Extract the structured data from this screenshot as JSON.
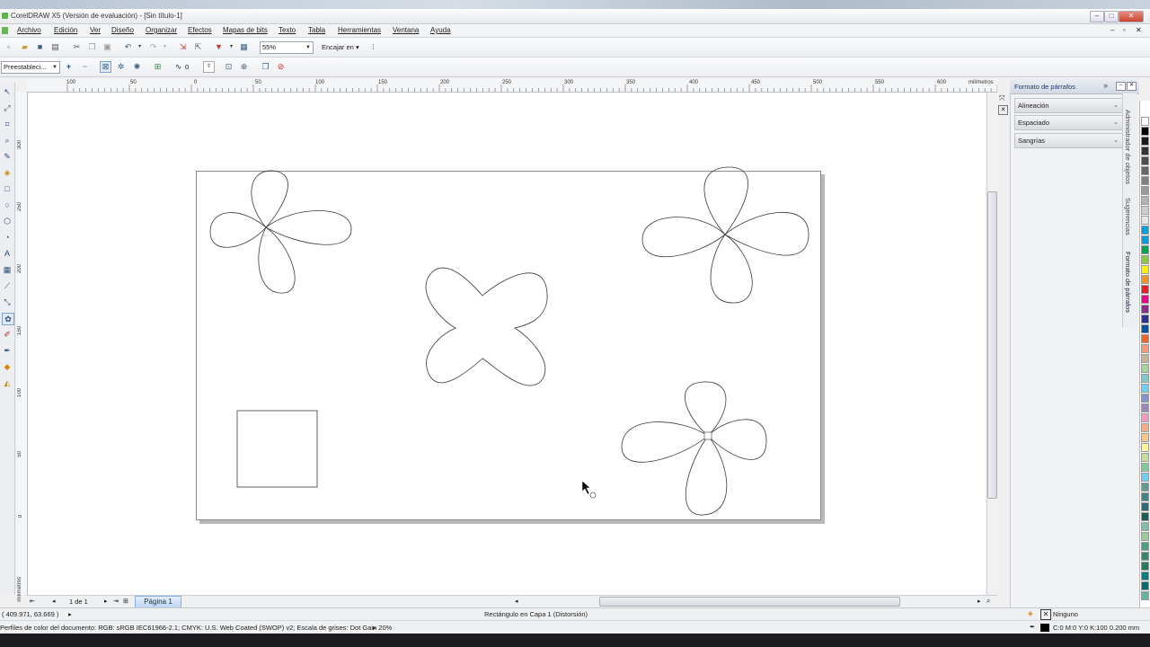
{
  "window": {
    "title": "CorelDRAW X5 (Versión de evaluación) - [Sin título-1]"
  },
  "menu": [
    "Archivo",
    "Edición",
    "Ver",
    "Diseño",
    "Organizar",
    "Efectos",
    "Mapas de bits",
    "Texto",
    "Tabla",
    "Herramientas",
    "Ventana",
    "Ayuda"
  ],
  "toolbar": {
    "zoom": "55%",
    "snap_label": "Encajar en"
  },
  "propertybar": {
    "preset": "Preestableci...",
    "distortion_value": "0"
  },
  "ruler": {
    "unit": "milímetros",
    "h_ticks": [
      "100",
      "50",
      "0",
      "50",
      "100",
      "150",
      "200",
      "250",
      "300",
      "350",
      "400",
      "450",
      "500",
      "550",
      "600"
    ],
    "v_ticks": [
      "300",
      "250",
      "200",
      "150",
      "100",
      "50",
      "0"
    ]
  },
  "page_nav": {
    "count": "1 de 1",
    "page_tab": "Página 1"
  },
  "docker": {
    "title": "Formato de párrafos",
    "sections": [
      "Alineación",
      "Espaciado",
      "Sangrías"
    ],
    "side_tabs": [
      "Administrador de objetos",
      "Sugerencias",
      "Formato de párrafos"
    ]
  },
  "palette": [
    "#ffffff",
    "#000000",
    "#1a1a1a",
    "#333333",
    "#4d4d4d",
    "#666666",
    "#808080",
    "#999999",
    "#b3b3b3",
    "#cccccc",
    "#e6e6e6",
    "#00a0e3",
    "#009ee0",
    "#00a651",
    "#8dc63f",
    "#fff200",
    "#f7941d",
    "#ed1c24",
    "#ec008c",
    "#92278f",
    "#2e3192",
    "#0054a6",
    "#f26522",
    "#f7977a",
    "#c7b299",
    "#a3d39c",
    "#7accc8",
    "#6dcff6",
    "#8393ca",
    "#a186be",
    "#f49ac2",
    "#f9ad81",
    "#fdc689",
    "#fff799",
    "#c4df9b",
    "#82ca9c",
    "#6ecff6",
    "#5e9b95",
    "#3b8686",
    "#2a6f6f",
    "#1e5c5c",
    "#7dbfa8",
    "#99cc99",
    "#4da381",
    "#338a6b",
    "#2b7a5e",
    "#00807f",
    "#00706e",
    "#66b2a3"
  ],
  "status": {
    "coords": "( 409.971, 63.669 )",
    "object_info": "Rectángulo en Capa 1  (Distorsión)",
    "fill": "Ninguno",
    "color_profile": "Perfiles de color del documento: RGB: sRGB IEC61966-2.1; CMYK: U.S. Web Coated (SWOP) v2; Escala de grises: Dot Gain 20%",
    "outline": "C:0 M:0 Y:0 K:100  0.200 mm"
  }
}
